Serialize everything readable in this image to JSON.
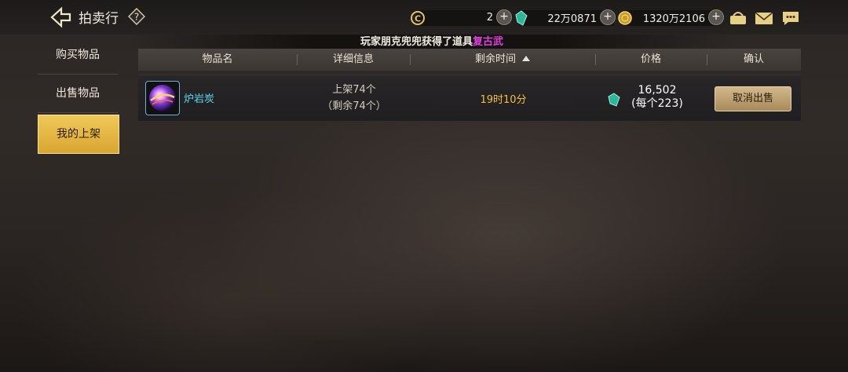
{
  "header": {
    "title": "拍卖行",
    "back_icon": "back-arrow-icon",
    "help_icon": "question-mark-icon"
  },
  "currencies": [
    {
      "name": "c-coin",
      "value": "2"
    },
    {
      "name": "green-gem",
      "value": "22万0871"
    },
    {
      "name": "gold-coin",
      "value": "1320万2106"
    }
  ],
  "notice": {
    "prefix": "玩家朋克兜兜获得了道具",
    "highlight": "复古武"
  },
  "sidebar": {
    "items": [
      {
        "label": "购买物品"
      },
      {
        "label": "出售物品"
      },
      {
        "label": "我的上架"
      }
    ],
    "active_index": 2
  },
  "table": {
    "columns": [
      "物品名",
      "详细信息",
      "剩余时间",
      "价格",
      "确认"
    ],
    "sort_column": "剩余时间",
    "rows": [
      {
        "name": "炉岩炭",
        "detail_line1": "上架74个",
        "detail_line2": "（剩余74个）",
        "time_left": "19时10分",
        "price_total": "16,502",
        "price_each": "(每个223)",
        "action": "取消出售"
      }
    ]
  },
  "colors": {
    "accent_gold": "#d9a530",
    "item_name": "#58d8f0",
    "time_left": "#f0c040",
    "notice_highlight": "#e040e0"
  }
}
